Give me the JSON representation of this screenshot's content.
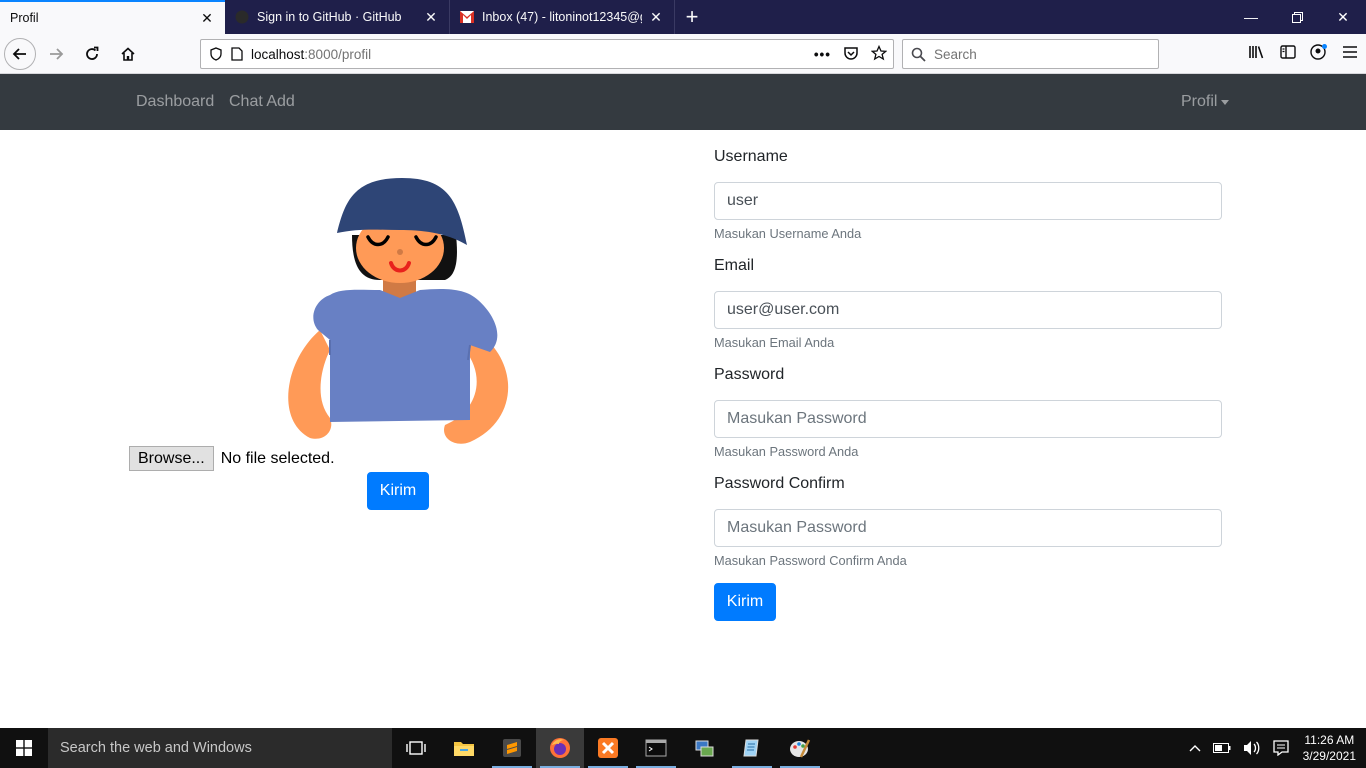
{
  "browser": {
    "tabs": [
      {
        "title": "Profil",
        "active": true,
        "icon": "none"
      },
      {
        "title": "Sign in to GitHub · GitHub",
        "active": false,
        "icon": "github-icon"
      },
      {
        "title": "Inbox (47) - litoninot12345@gm",
        "active": false,
        "icon": "gmail-icon"
      }
    ],
    "url_host": "localhost",
    "url_path": ":8000/profil",
    "search_placeholder": "Search"
  },
  "navbar": {
    "links": [
      "Dashboard",
      "Chat Add"
    ],
    "profile_menu": "Profil"
  },
  "upload": {
    "browse_label": "Browse...",
    "file_status": "No file selected.",
    "submit_label": "Kirim"
  },
  "form": {
    "username": {
      "label": "Username",
      "value": "user",
      "help": "Masukan Username Anda"
    },
    "email": {
      "label": "Email",
      "value": "user@user.com",
      "help": "Masukan Email Anda"
    },
    "password": {
      "label": "Password",
      "placeholder": "Masukan Password",
      "help": "Masukan Password Anda"
    },
    "password_confirm": {
      "label": "Password Confirm",
      "placeholder": "Masukan Password",
      "help": "Masukan Password Confirm Anda"
    },
    "submit_label": "Kirim"
  },
  "taskbar": {
    "search_placeholder": "Search the web and Windows",
    "time": "11:26 AM",
    "date": "3/29/2021"
  },
  "colors": {
    "primary": "#007bff",
    "navbar_bg": "#343a40",
    "tabstrip_bg": "#1f1f4a"
  }
}
